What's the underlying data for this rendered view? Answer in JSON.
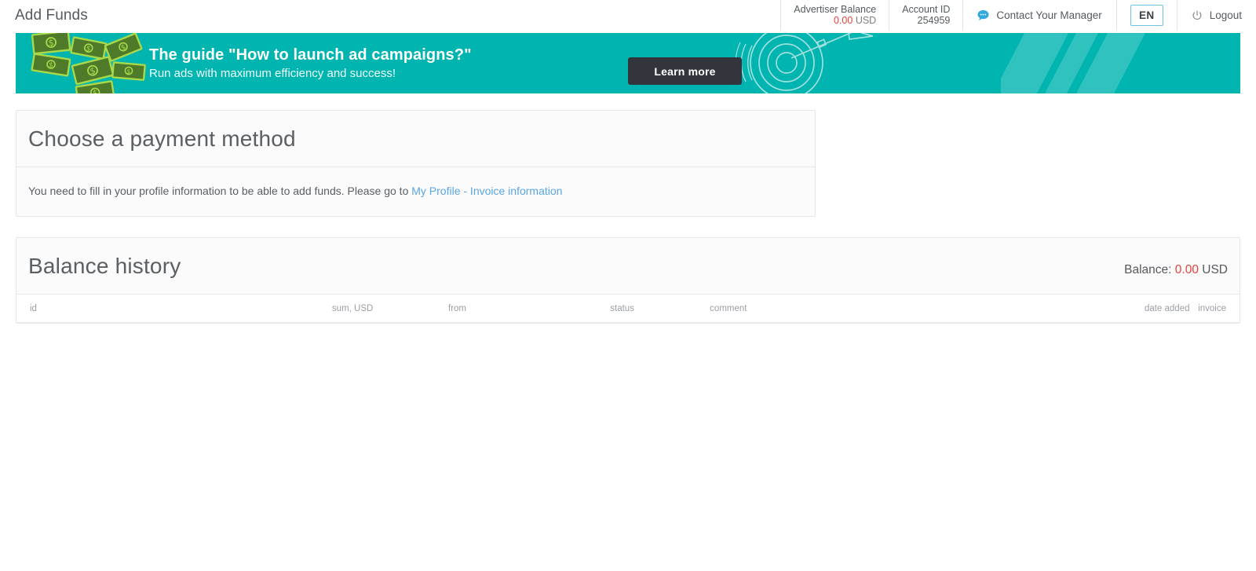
{
  "header": {
    "page_title": "Add Funds",
    "advertiser_balance": {
      "label": "Advertiser Balance",
      "amount": "0.00",
      "currency": "USD"
    },
    "account": {
      "label": "Account ID",
      "value": "254959"
    },
    "contact_manager": {
      "label": "Contact Your Manager",
      "icon": "chat-bubble-icon"
    },
    "language": {
      "selected": "EN"
    },
    "logout": {
      "label": "Logout",
      "icon": "power-icon"
    }
  },
  "banner": {
    "headline": "The guide \"How to launch ad campaigns?\"",
    "subline": "Run ads with maximum efficiency and success!",
    "cta_label": "Learn more",
    "background_color": "#00b4b0",
    "cta_background": "#32363c",
    "art_left": "falling-money-bills-icon",
    "art_right": "dartboard-target-icon"
  },
  "payment_card": {
    "title": "Choose a payment method",
    "notice_prefix": "You need to fill in your profile information to be able to add funds. Please go to ",
    "notice_link": "My Profile - Invoice information",
    "link_color": "#5aa6e0"
  },
  "balance_history": {
    "title": "Balance history",
    "balance_label": "Balance:",
    "balance_amount": "0.00",
    "balance_currency": "USD",
    "balance_color": "#e8413c",
    "columns": [
      "id",
      "sum, USD",
      "from",
      "status",
      "comment",
      "date added",
      "invoice"
    ],
    "rows": []
  }
}
